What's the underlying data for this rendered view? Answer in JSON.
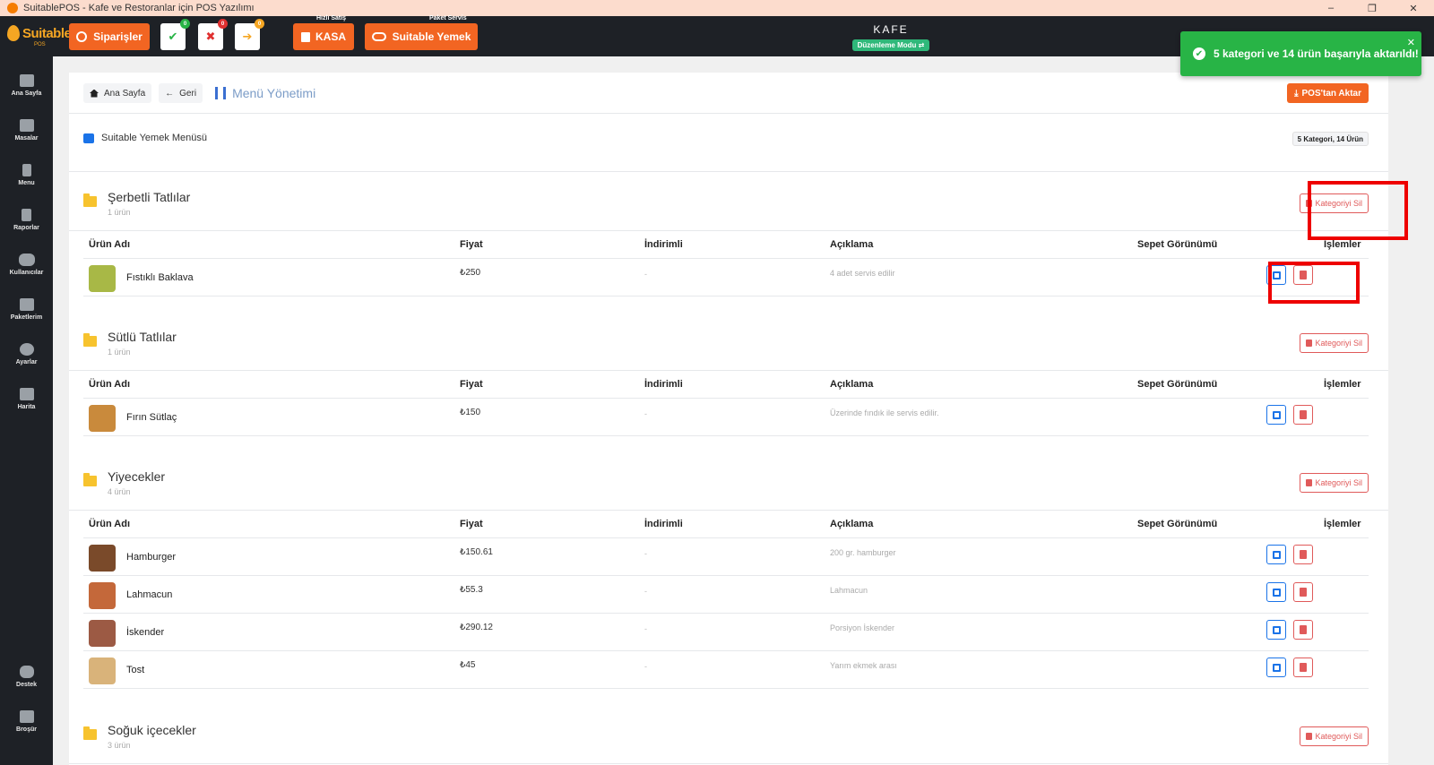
{
  "window": {
    "title": "SuitablePOS - Kafe ve Restoranlar için POS Yazılımı",
    "minimize": "–",
    "restore": "❐",
    "close": "✕"
  },
  "topnav": {
    "logo_text": "Suitable",
    "logo_sub": "POS",
    "orders_label": "Siparişler",
    "approve_badge": "0",
    "reject_badge": "0",
    "forward_badge": "0",
    "approve_glyph": "✔",
    "reject_glyph": "✖",
    "forward_glyph": "➔",
    "quick_sale_caption": "Hızlı Satış",
    "kasa_label": "KASA",
    "package_caption": "Paket Servis",
    "suitable_food_label": "Suitable Yemek",
    "business_name": "KAFE",
    "mode_label": "Düzenleme Modu"
  },
  "sidebar": {
    "items": [
      {
        "label": "Ana Sayfa",
        "icon": "home-icon"
      },
      {
        "label": "Masalar",
        "icon": "table-icon"
      },
      {
        "label": "Menu",
        "icon": "utensils-icon"
      },
      {
        "label": "Raporlar",
        "icon": "report-icon"
      },
      {
        "label": "Kullanıcılar",
        "icon": "users-icon"
      },
      {
        "label": "Paketlerim",
        "icon": "gift-icon"
      },
      {
        "label": "Ayarlar",
        "icon": "gears-icon"
      },
      {
        "label": "Harita",
        "icon": "map-icon"
      },
      {
        "label": "Destek",
        "icon": "chat-icon"
      },
      {
        "label": "Broşür",
        "icon": "brochure-icon"
      }
    ]
  },
  "header": {
    "home": "Ana Sayfa",
    "back": "Geri",
    "title": "Menü Yönetimi",
    "export_button": "POS'tan Aktar"
  },
  "menu": {
    "name": "Suitable Yemek Menüsü",
    "summary": "5 Kategori, 14 Ürün"
  },
  "columns": {
    "name": "Ürün Adı",
    "price": "Fiyat",
    "discount": "İndirimli",
    "description": "Açıklama",
    "basket_view": "Sepet Görünümü",
    "actions": "İşlemler"
  },
  "delete_category_label": "Kategoriyi Sil",
  "categories": [
    {
      "title": "Şerbetli Tatlılar",
      "count": "1 ürün",
      "products": [
        {
          "name": "Fıstıklı Baklava",
          "price": "₺250",
          "discount": "-",
          "description": "4 adet servis edilir",
          "thumb": "#a8b846"
        }
      ]
    },
    {
      "title": "Sütlü Tatlılar",
      "count": "1 ürün",
      "products": [
        {
          "name": "Fırın Sütlaç",
          "price": "₺150",
          "discount": "-",
          "description": "Üzerinde fındık ile servis edilir.",
          "thumb": "#c98a3c"
        }
      ]
    },
    {
      "title": "Yiyecekler",
      "count": "4 ürün",
      "products": [
        {
          "name": "Hamburger",
          "price": "₺150.61",
          "discount": "-",
          "description": "200 gr. hamburger",
          "thumb": "#7a4a2a"
        },
        {
          "name": "Lahmacun",
          "price": "₺55.3",
          "discount": "-",
          "description": "Lahmacun",
          "thumb": "#c4683a"
        },
        {
          "name": "İskender",
          "price": "₺290.12",
          "discount": "-",
          "description": "Porsiyon İskender",
          "thumb": "#9c5a44"
        },
        {
          "name": "Tost",
          "price": "₺45",
          "discount": "-",
          "description": "Yarım ekmek arası",
          "thumb": "#d9b37a"
        }
      ]
    },
    {
      "title": "Soğuk içecekler",
      "count": "3 ürün",
      "products": []
    }
  ],
  "toast": {
    "message": "5 kategori ve 14 ürün başarıyla aktarıldı!",
    "check_glyph": "✔",
    "close_glyph": "✕"
  },
  "colors": {
    "accent_orange": "#f26522",
    "sidebar_bg": "#1e2126",
    "toast_green": "#28b446",
    "danger_red": "#e05a5a",
    "edit_blue": "#1a73e8"
  }
}
